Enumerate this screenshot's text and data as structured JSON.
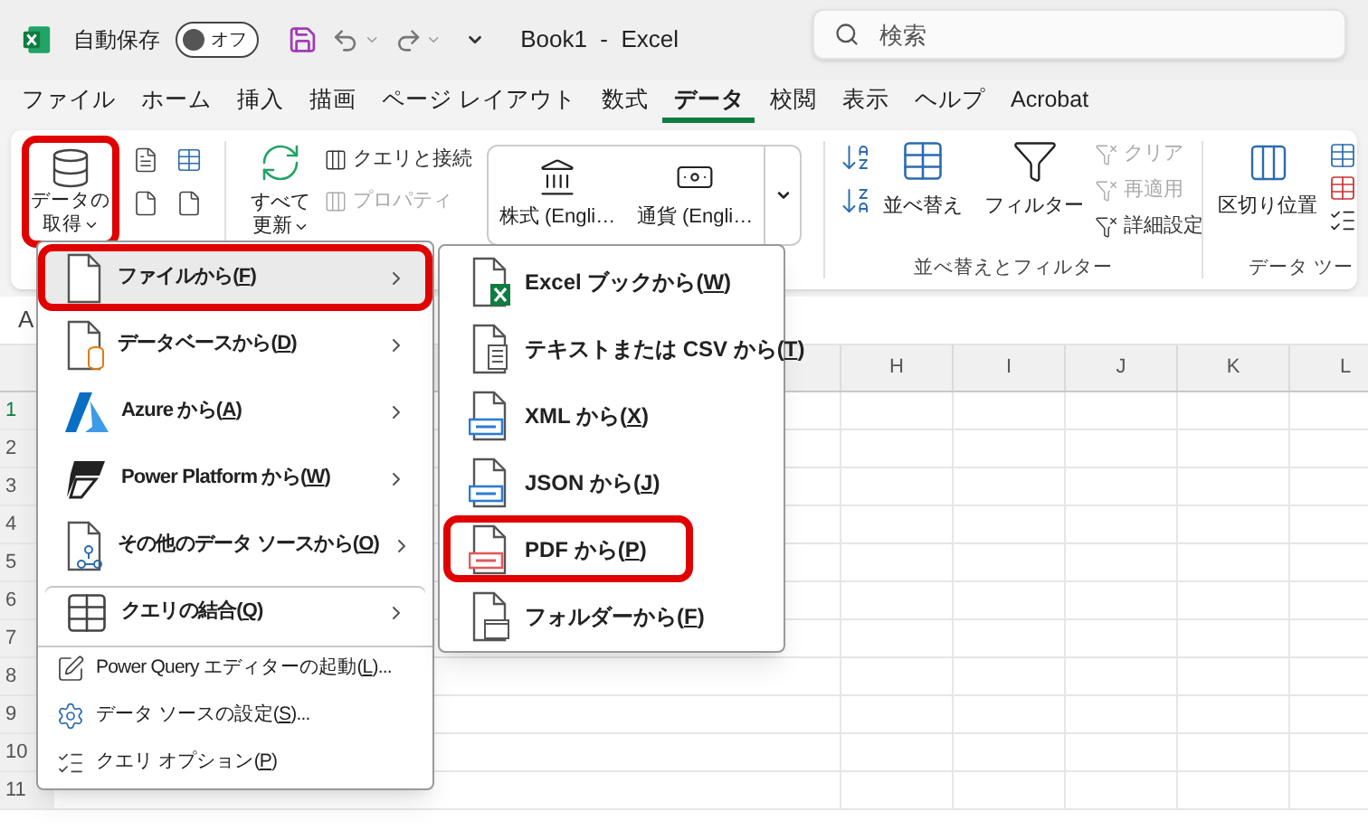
{
  "title_bar": {
    "autosave_label": "自動保存",
    "autosave": {
      "on": false,
      "label": "オフ"
    },
    "document_title": "Book1  -  Excel",
    "search": {
      "placeholder": "検索"
    }
  },
  "menu_tabs": [
    {
      "label": "ファイル",
      "selected": false
    },
    {
      "label": "ホーム",
      "selected": false
    },
    {
      "label": "挿入",
      "selected": false
    },
    {
      "label": "描画",
      "selected": false
    },
    {
      "label": "ページ レイアウト",
      "selected": false
    },
    {
      "label": "数式",
      "selected": false
    },
    {
      "label": "データ",
      "selected": true
    },
    {
      "label": "校閲",
      "selected": false
    },
    {
      "label": "表示",
      "selected": false
    },
    {
      "label": "ヘルプ",
      "selected": false
    },
    {
      "label": "Acrobat",
      "selected": false
    }
  ],
  "ribbon": {
    "get_data": {
      "line1": "データの",
      "line2": "取得",
      "annotated": true
    },
    "refresh_all": {
      "line1": "すべて",
      "line2": "更新"
    },
    "query_commands": [
      {
        "label": "クエリと接続",
        "disabled": false
      },
      {
        "label": "プロパティ",
        "disabled": true
      }
    ],
    "data_types": [
      {
        "label": "株式 (Engli…"
      },
      {
        "label": "通貨 (Engli…"
      }
    ],
    "sort_filter": {
      "sort_label": "並べ替え",
      "filter_label": "フィルター",
      "commands": [
        {
          "label": "クリア",
          "disabled": true
        },
        {
          "label": "再適用",
          "disabled": true
        },
        {
          "label": "詳細設定",
          "disabled": false
        }
      ],
      "group_label": "並べ替えとフィルター"
    },
    "data_tools": {
      "text_to_columns": "区切り位置",
      "group_label": "データ ツー"
    }
  },
  "name_box": "A",
  "columns": [
    "H",
    "I",
    "J",
    "K",
    "L"
  ],
  "rows": [
    {
      "label": "1",
      "active": true
    },
    {
      "label": "2",
      "active": false
    },
    {
      "label": "3",
      "active": false
    },
    {
      "label": "4",
      "active": false
    },
    {
      "label": "5",
      "active": false
    },
    {
      "label": "6",
      "active": false
    },
    {
      "label": "7",
      "active": false
    },
    {
      "label": "8",
      "active": false
    },
    {
      "label": "9",
      "active": false
    },
    {
      "label": "10",
      "active": false
    },
    {
      "label": "11",
      "active": false
    }
  ],
  "get_data_menu": [
    {
      "kind": "large",
      "before": "ファイルから(",
      "key": "F",
      "after": ")",
      "submenu": true,
      "selected": true,
      "annotated": true,
      "divider_above": false
    },
    {
      "kind": "large",
      "before": "データベースから(",
      "key": "D",
      "after": ")",
      "submenu": true,
      "selected": false,
      "annotated": false,
      "divider_above": false
    },
    {
      "kind": "large",
      "before": "Azure から(",
      "key": "A",
      "after": ")",
      "submenu": true,
      "selected": false,
      "annotated": false,
      "divider_above": false
    },
    {
      "kind": "large",
      "before": "Power Platform から(",
      "key": "W",
      "after": ")",
      "submenu": true,
      "selected": false,
      "annotated": false,
      "divider_above": false
    },
    {
      "kind": "large",
      "before": "その他のデータ ソースから(",
      "key": "O",
      "after": ")",
      "submenu": true,
      "selected": false,
      "annotated": false,
      "divider_above": false
    },
    {
      "kind": "large",
      "before": "クエリの結合(",
      "key": "Q",
      "after": ")",
      "submenu": true,
      "selected": false,
      "annotated": false,
      "divider_above": true
    },
    {
      "kind": "small",
      "before": "Power Query エディターの起動(",
      "key": "L",
      "after": ")...",
      "submenu": false,
      "selected": false,
      "annotated": false,
      "divider_above": true
    },
    {
      "kind": "small",
      "before": "データ ソースの設定(",
      "key": "S",
      "after": ")...",
      "submenu": false,
      "selected": false,
      "annotated": false,
      "divider_above": false
    },
    {
      "kind": "small",
      "before": "クエリ オプション(",
      "key": "P",
      "after": ")",
      "submenu": false,
      "selected": false,
      "annotated": false,
      "divider_above": false
    }
  ],
  "file_submenu": [
    {
      "before": "Excel ブックから(",
      "key": "W",
      "after": ")",
      "annotated": false
    },
    {
      "before": "テキストまたは CSV から(",
      "key": "T",
      "after": ")",
      "annotated": false
    },
    {
      "before": "XML から(",
      "key": "X",
      "after": ")",
      "annotated": false
    },
    {
      "before": "JSON から(",
      "key": "J",
      "after": ")",
      "annotated": false
    },
    {
      "before": "PDF から(",
      "key": "P",
      "after": ")",
      "annotated": true
    },
    {
      "before": "フォルダーから(",
      "key": "F",
      "after": ")",
      "annotated": false
    }
  ]
}
